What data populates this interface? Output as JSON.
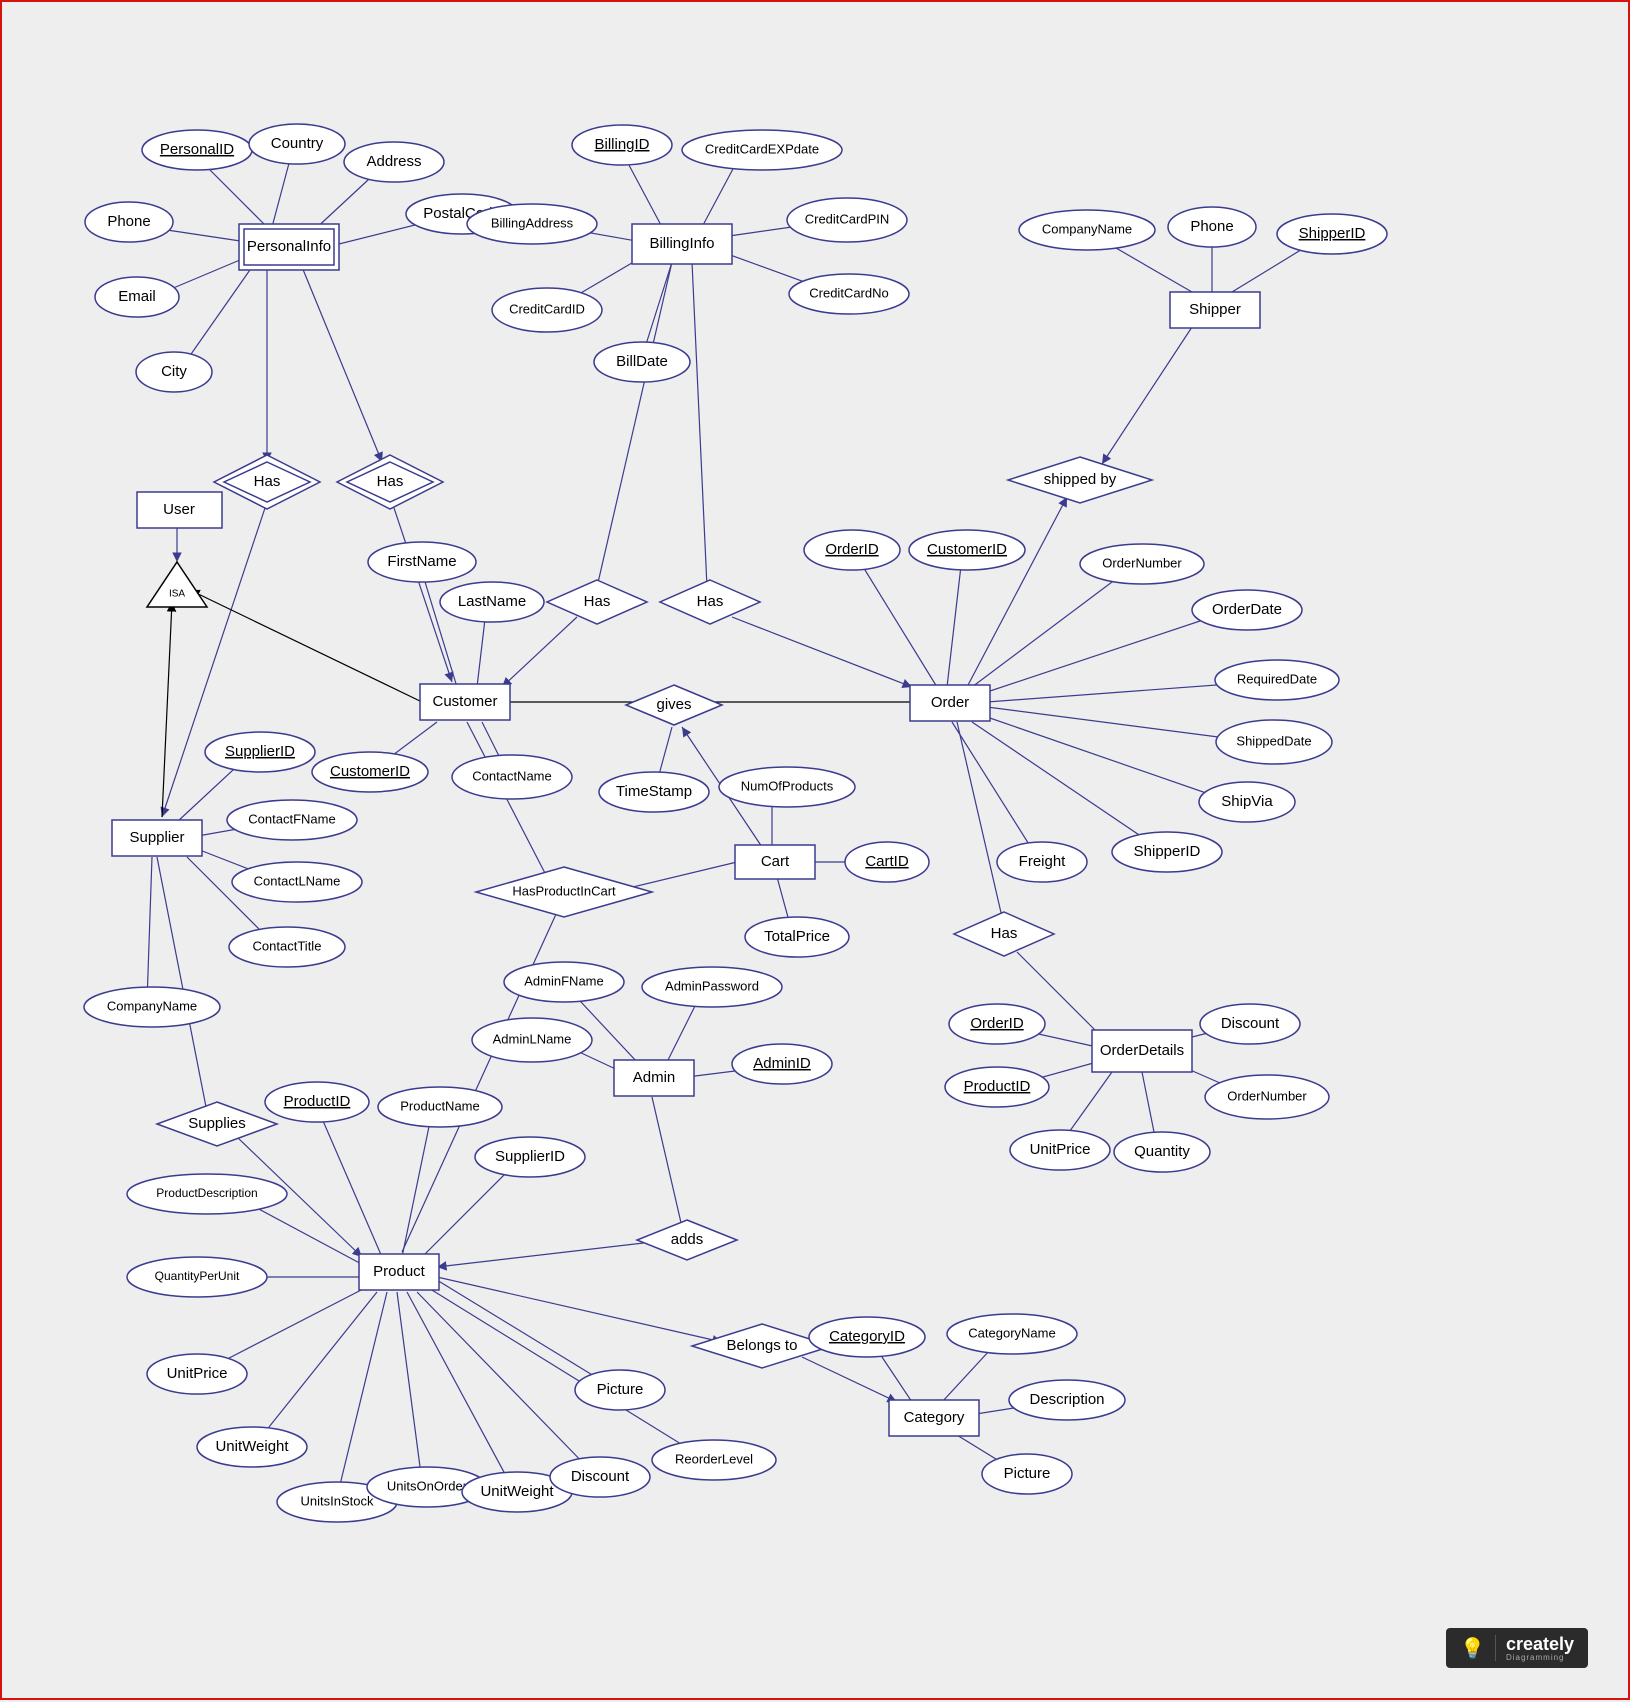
{
  "logo": {
    "brand": "creately",
    "sub": "Diagramming"
  },
  "isa": "ISA",
  "entities": {
    "user": "User",
    "personalinfo": "PersonalInfo",
    "billinginfo": "BillingInfo",
    "shipper": "Shipper",
    "customer": "Customer",
    "order": "Order",
    "cart": "Cart",
    "supplier": "Supplier",
    "admin": "Admin",
    "product": "Product",
    "orderdetails": "OrderDetails",
    "category": "Category"
  },
  "rel": {
    "has1": "Has",
    "has2": "Has",
    "has3": "Has",
    "has4": "Has",
    "has5": "Has",
    "has6": "Has",
    "shippedby": "shipped by",
    "gives": "gives",
    "hasproductincart": "HasProductInCart",
    "supplies": "Supplies",
    "adds": "adds",
    "belongsto": "Belongs to"
  },
  "attrs": {
    "personalid": "PersonalID",
    "country": "Country",
    "address": "Address",
    "postalcode": "PostalCode",
    "phone1": "Phone",
    "email": "Email",
    "city": "City",
    "billingid": "BillingID",
    "creditcardexpdate": "CreditCardEXPdate",
    "billingaddress": "BillingAddress",
    "creditcardpin": "CreditCardPIN",
    "creditcardid": "CreditCardID",
    "creditcardno": "CreditCardNo",
    "billdate": "BillDate",
    "companyname1": "CompanyName",
    "phone2": "Phone",
    "shipperid": "ShipperID",
    "firstname": "FirstName",
    "lastname": "LastName",
    "customerid": "CustomerID",
    "contactname": "ContactName",
    "orderid": "OrderID",
    "customerid2": "CustomerID",
    "ordernumber": "OrderNumber",
    "orderdate": "OrderDate",
    "requireddate": "RequiredDate",
    "shippeddate": "ShippedDate",
    "shipvia": "ShipVia",
    "shipperid2": "ShipperID",
    "freight": "Freight",
    "timestamp": "TimeStamp",
    "numofproducts": "NumOfProducts",
    "cartid": "CartID",
    "totalprice": "TotalPrice",
    "supplierid": "SupplierID",
    "contactfname": "ContactFName",
    "contactlname": "ContactLName",
    "contacttitle": "ContactTitle",
    "companyname2": "CompanyName",
    "adminfname": "AdminFName",
    "adminlname": "AdminLName",
    "adminpassword": "AdminPassword",
    "adminid": "AdminID",
    "orderid2": "OrderID",
    "productid2": "ProductID",
    "discount2": "Discount",
    "ordernumber2": "OrderNumber",
    "unitprice2": "UnitPrice",
    "quantity": "Quantity",
    "productid": "ProductID",
    "productname": "ProductName",
    "supplierid2": "SupplierID",
    "productdescription": "ProductDescription",
    "quantityperunit": "QuantityPerUnit",
    "unitprice": "UnitPrice",
    "unitweight": "UnitWeight",
    "unitsinstock": "UnitsInStock",
    "unitsonorder": "UnitsOnOrder",
    "unitweight2": "UnitWeight",
    "discount": "Discount",
    "reorderlevel": "ReorderLevel",
    "picture": "Picture",
    "categoryid": "CategoryID",
    "categoryname": "CategoryName",
    "description": "Description",
    "picture2": "Picture"
  }
}
